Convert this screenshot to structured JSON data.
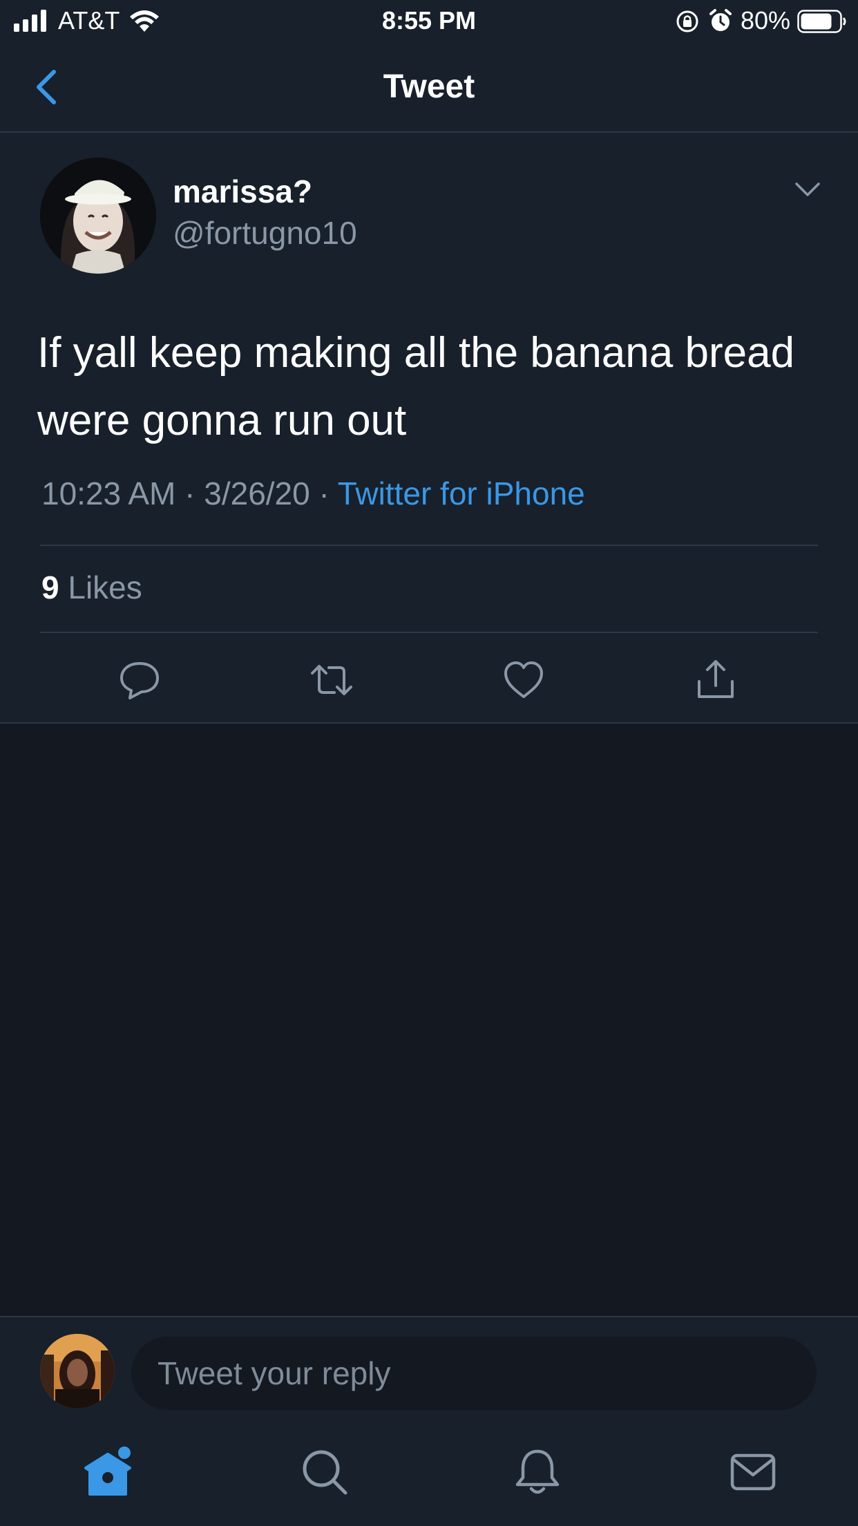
{
  "status_bar": {
    "carrier": "AT&T",
    "time": "8:55 PM",
    "battery_percent": "80%"
  },
  "nav": {
    "title": "Tweet",
    "back_icon": "chevron-left-icon"
  },
  "tweet": {
    "display_name": "marissa?",
    "handle": "@fortugno10",
    "text": "If yall keep making all the banana bread were gonna run out",
    "time": "10:23 AM",
    "date": "3/26/20",
    "separator": "·",
    "source": "Twitter for iPhone",
    "likes_count": "9",
    "likes_label": "Likes"
  },
  "actions": {
    "reply_icon": "reply-icon",
    "retweet_icon": "retweet-icon",
    "like_icon": "heart-icon",
    "share_icon": "share-icon"
  },
  "composer": {
    "placeholder": "Tweet your reply"
  },
  "tab_bar": {
    "items": [
      "home-icon",
      "search-icon",
      "notifications-icon",
      "messages-icon"
    ],
    "active": "home-icon"
  },
  "colors": {
    "background": "#141820",
    "surface": "#18202b",
    "accent": "#3a98e6",
    "secondary_text": "#8a97a6",
    "divider": "#2e3846"
  }
}
